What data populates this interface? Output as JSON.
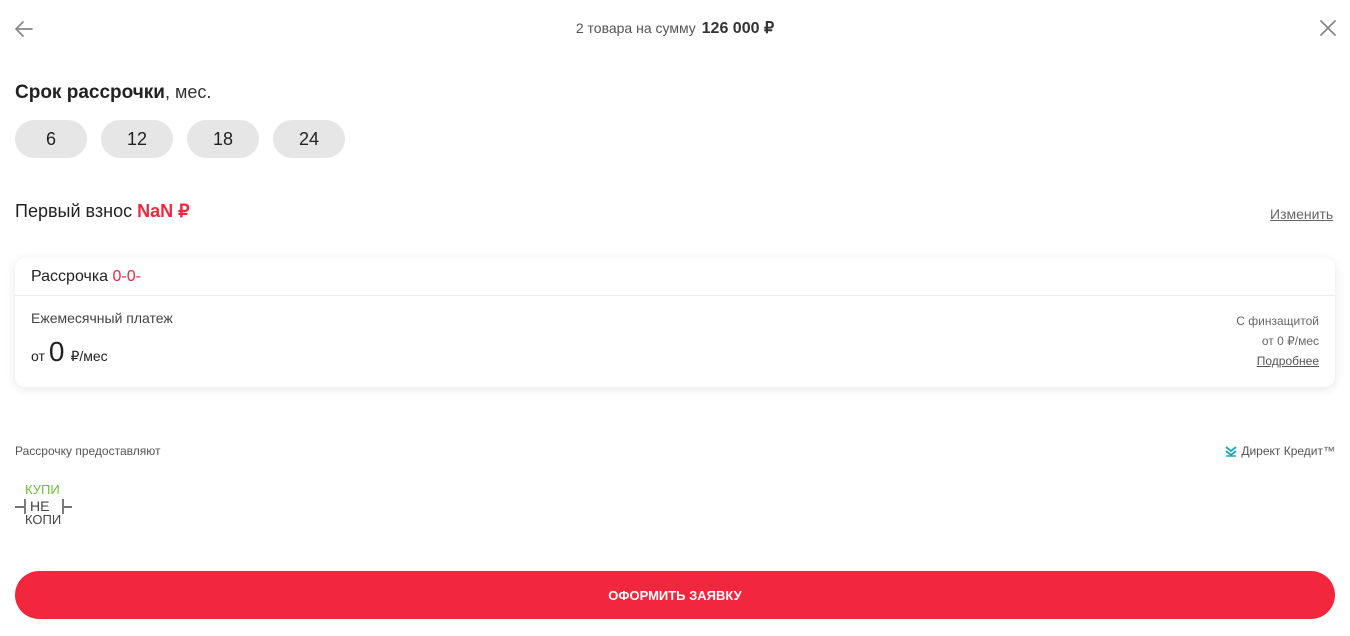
{
  "header": {
    "summary_prefix": "2 товара на сумму",
    "summary_amount": "126 000 ₽",
    "back_icon": "arrow-left-icon",
    "close_icon": "close-icon"
  },
  "term": {
    "title": "Срок рассрочки",
    "unit": ", мес.",
    "options": [
      "6",
      "12",
      "18",
      "24"
    ]
  },
  "down_payment": {
    "label": "Первый взнос",
    "value": "NaN ₽",
    "change_label": "Изменить"
  },
  "plan": {
    "title": "Рассрочка",
    "code": "0-0-",
    "monthly_label": "Ежемесячный платеж",
    "amount_prefix": "от",
    "amount": "0",
    "amount_suffix": "₽/мес",
    "protection_label": "С финзащитой",
    "protection_amount": "от 0 ₽/мес",
    "details_label": "Подробнее"
  },
  "providers": {
    "label": "Рассрочку предоставляют",
    "direct_credit": "Директ Кредит™",
    "logo_lines": [
      "КУПИ",
      "НЕ",
      "КОПИ"
    ]
  },
  "submit": {
    "label": "ОФОРМИТЬ ЗАЯВКУ"
  },
  "colors": {
    "accent": "#f2263c",
    "chip_bg": "#e6e6e6",
    "logo_green": "#6cbf3a",
    "direct_credit_teal": "#1ba3b5"
  }
}
